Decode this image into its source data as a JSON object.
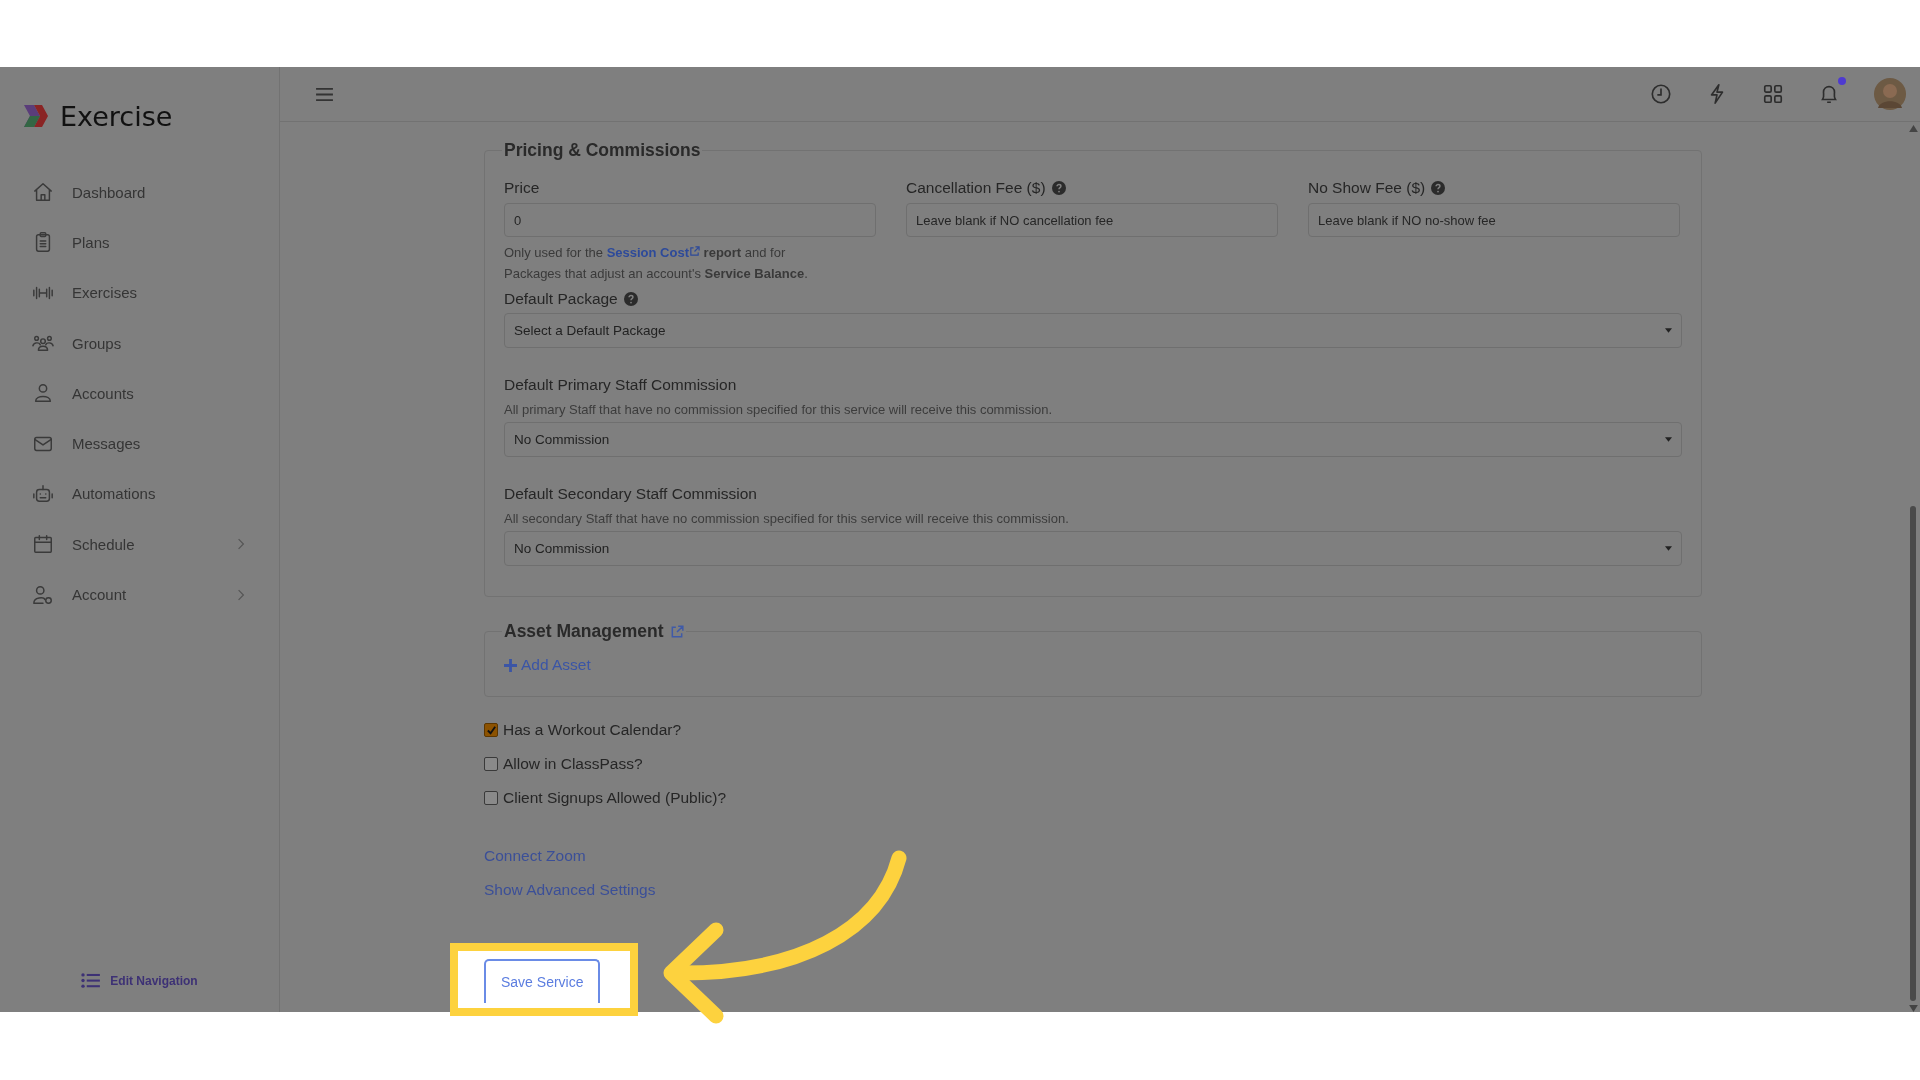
{
  "app": {
    "name": "Exercise"
  },
  "sidebar": {
    "items": [
      {
        "label": "Dashboard",
        "kind": "home",
        "expandable": false
      },
      {
        "label": "Plans",
        "kind": "clipboard",
        "expandable": false
      },
      {
        "label": "Exercises",
        "kind": "dumbbell",
        "expandable": false
      },
      {
        "label": "Groups",
        "kind": "people",
        "expandable": false
      },
      {
        "label": "Accounts",
        "kind": "person",
        "expandable": false
      },
      {
        "label": "Messages",
        "kind": "mail",
        "expandable": false
      },
      {
        "label": "Automations",
        "kind": "robot",
        "expandable": false
      },
      {
        "label": "Schedule",
        "kind": "calendar",
        "expandable": true
      },
      {
        "label": "Account",
        "kind": "person-gear",
        "expandable": true
      }
    ],
    "footer": "Edit Navigation"
  },
  "header": {
    "notifications_unread": true
  },
  "pricing": {
    "title": "Pricing & Commissions",
    "fields": [
      {
        "label": "Price",
        "value": "0",
        "help": false
      },
      {
        "label": "Cancellation Fee ($)",
        "placeholder": "Leave blank if NO cancellation fee",
        "help": true
      },
      {
        "label": "No Show Fee ($)",
        "placeholder": "Leave blank if NO no-show fee",
        "help": true
      }
    ],
    "note": {
      "before": "Only used for the",
      "link": "Session Cost",
      "after": "**report** and for Packages that adjust an account's **Service Balance**."
    },
    "selects": [
      {
        "label": "Default Package",
        "help": true,
        "value": "Select a Default Package"
      },
      {
        "label": "Default Primary Staff Commission",
        "help": false,
        "description": "All primary Staff that have no commission specified for this service will receive this commission.",
        "value": "No Commission"
      },
      {
        "label": "Default Secondary Staff Commission",
        "help": false,
        "description": "All secondary Staff that have no commission specified for this service will receive this commission.",
        "value": "No Commission"
      }
    ]
  },
  "assets": {
    "title": "Asset Management",
    "add": "Add Asset"
  },
  "checkboxes": [
    {
      "label": "Has a Workout Calendar?",
      "checked": true
    },
    {
      "label": "Allow in ClassPass?",
      "checked": false
    },
    {
      "label": "Client Signups Allowed (Public)?",
      "checked": false
    }
  ],
  "links": [
    "Connect Zoom",
    "Show Advanced Settings"
  ],
  "save_button": "Save Service"
}
